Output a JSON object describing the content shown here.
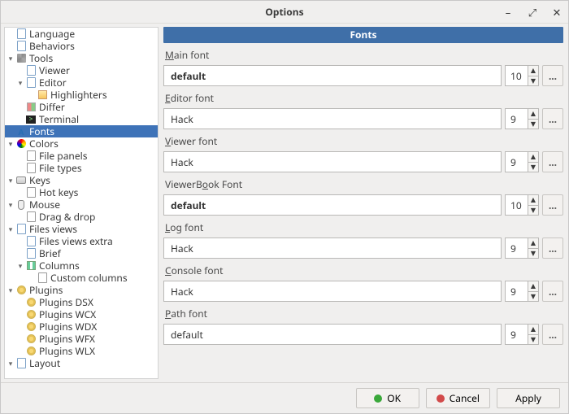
{
  "window": {
    "title": "Options"
  },
  "banner": "Fonts",
  "tree": {
    "language": "Language",
    "behaviors": "Behaviors",
    "tools": "Tools",
    "viewer": "Viewer",
    "editor": "Editor",
    "highlighters": "Highlighters",
    "differ": "Differ",
    "terminal": "Terminal",
    "fonts": "Fonts",
    "colors": "Colors",
    "file_panels": "File panels",
    "file_types": "File types",
    "keys": "Keys",
    "hot_keys": "Hot keys",
    "mouse": "Mouse",
    "drag_drop": "Drag & drop",
    "files_views": "Files views",
    "files_views_extra": "Files views extra",
    "brief": "Brief",
    "columns": "Columns",
    "custom_columns": "Custom columns",
    "plugins": "Plugins",
    "plugins_dsx": "Plugins DSX",
    "plugins_wcx": "Plugins WCX",
    "plugins_wdx": "Plugins WDX",
    "plugins_wfx": "Plugins WFX",
    "plugins_wlx": "Plugins WLX",
    "layout": "Layout"
  },
  "groups": [
    {
      "prefix": "M",
      "rest": "ain font",
      "value": "default",
      "bold": true,
      "size": 10
    },
    {
      "prefix": "E",
      "rest": "ditor font",
      "value": "Hack",
      "bold": false,
      "size": 9
    },
    {
      "prefix": "V",
      "rest": "iewer font",
      "value": "Hack",
      "bold": false,
      "size": 9
    },
    {
      "prefix": "",
      "rest": "ViewerBook Font",
      "raw": "ViewerB",
      "raw_u": "o",
      "raw_after": "ok Font",
      "value": "default",
      "bold": true,
      "size": 10
    },
    {
      "prefix": "L",
      "rest": "og font",
      "value": "Hack",
      "bold": false,
      "size": 9
    },
    {
      "prefix": "C",
      "rest": "onsole font",
      "value": "Hack",
      "bold": false,
      "size": 9
    },
    {
      "prefix": "",
      "rest": "Path font",
      "raw": "",
      "raw_u": "P",
      "raw_after": "ath font",
      "value": "default",
      "bold": false,
      "size": 9
    }
  ],
  "footer": {
    "ok": "OK",
    "cancel": "Cancel",
    "apply": "Apply"
  }
}
